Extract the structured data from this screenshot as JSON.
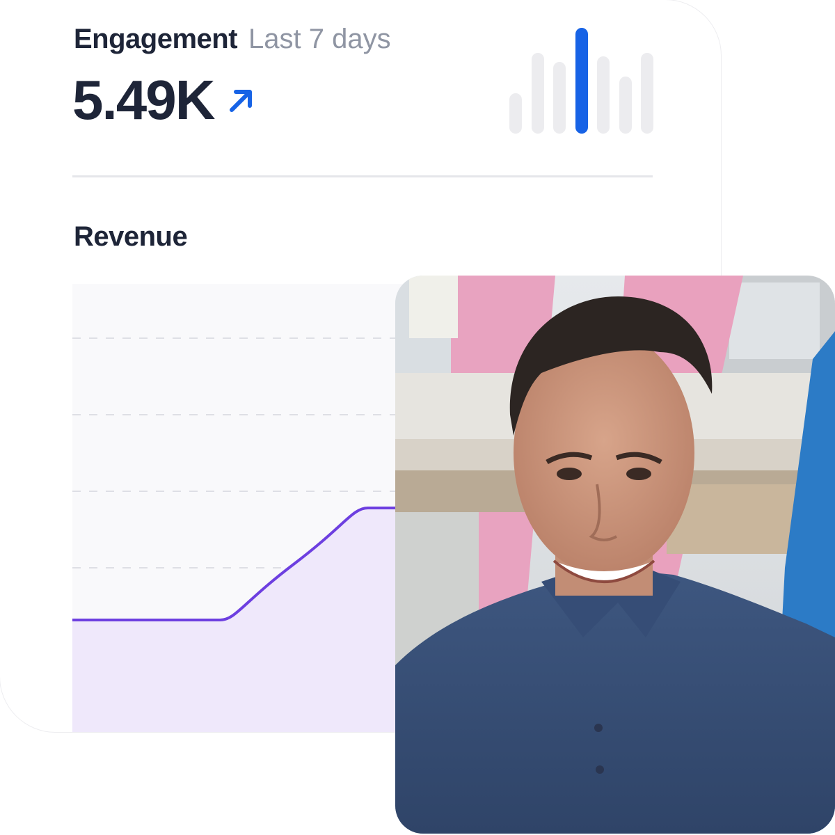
{
  "engagement": {
    "title": "Engagement",
    "period": "Last 7 days",
    "value": "5.49K",
    "trend_icon": "arrow-up-right-icon",
    "trend_color": "#1763e6",
    "daily_bar_levels": [
      0.38,
      0.76,
      0.68,
      1.0,
      0.73,
      0.54,
      0.76
    ],
    "highlighted_bar_index": 3
  },
  "revenue": {
    "title": "Revenue"
  },
  "photo": {
    "subject": "smiling-man-portrait"
  },
  "colors": {
    "text_primary": "#1e2538",
    "text_muted": "#8f95a3",
    "accent_blue": "#1763e6",
    "line_purple": "#6d3fe0",
    "area_fill": "#efe8fb"
  },
  "chart_data": {
    "type": "area",
    "title": "Revenue",
    "xlabel": "",
    "ylabel": "",
    "x": [
      0,
      1,
      2,
      3,
      4,
      5,
      6
    ],
    "values": [
      1.5,
      1.5,
      3.0,
      3.0,
      4.5,
      5.3,
      5.7
    ],
    "ylim": [
      0,
      6
    ],
    "grid": true,
    "legend": "none"
  }
}
